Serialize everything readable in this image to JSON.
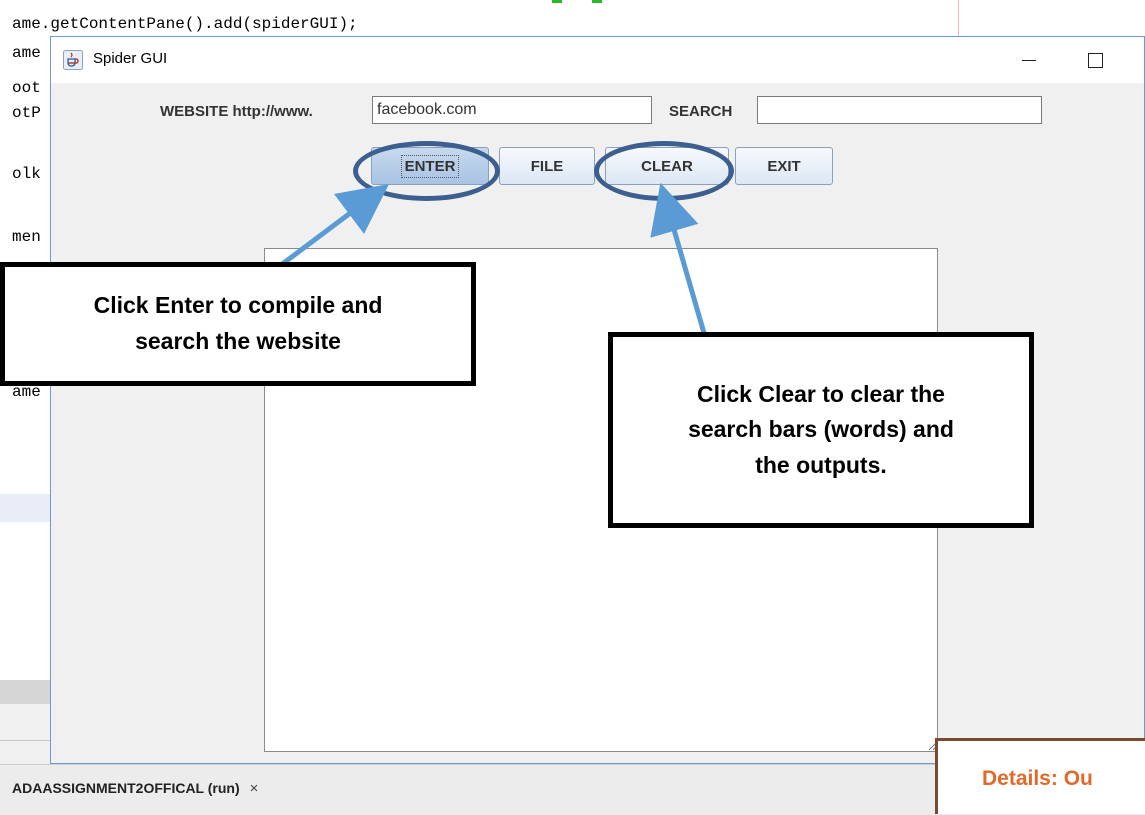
{
  "ide": {
    "code_lines": [
      "ame.getContentPane().add(spiderGUI);",
      "ame",
      "oot",
      "otP",
      "olk",
      "men",
      "ame"
    ],
    "output_tab": {
      "label": "ADAASSIGNMENT2OFFICAL (run)",
      "close_glyph": "×"
    }
  },
  "window": {
    "title": "Spider GUI",
    "icon": "java-coffee-cup-icon",
    "controls": {
      "minimize": "minimize-icon",
      "maximize": "maximize-icon",
      "close": "×"
    }
  },
  "form": {
    "website_label": "WEBSITE http://www.",
    "website_value": "facebook.com",
    "search_label": "SEARCH",
    "search_value": ""
  },
  "buttons": {
    "enter": "ENTER",
    "file": "FILE",
    "clear": "CLEAR",
    "exit": "EXIT"
  },
  "output": {
    "value": ""
  },
  "annotations": {
    "enter_callout": [
      "Click Enter to compile and",
      "search the website"
    ],
    "clear_callout": [
      "Click Clear to clear the",
      "search bars (words) and",
      "the outputs."
    ],
    "details_callout": "Details: Ou",
    "colors": {
      "ring": "#3d5f8f",
      "arrow": "#5b9bd5",
      "details_text": "#e06a2b"
    }
  }
}
